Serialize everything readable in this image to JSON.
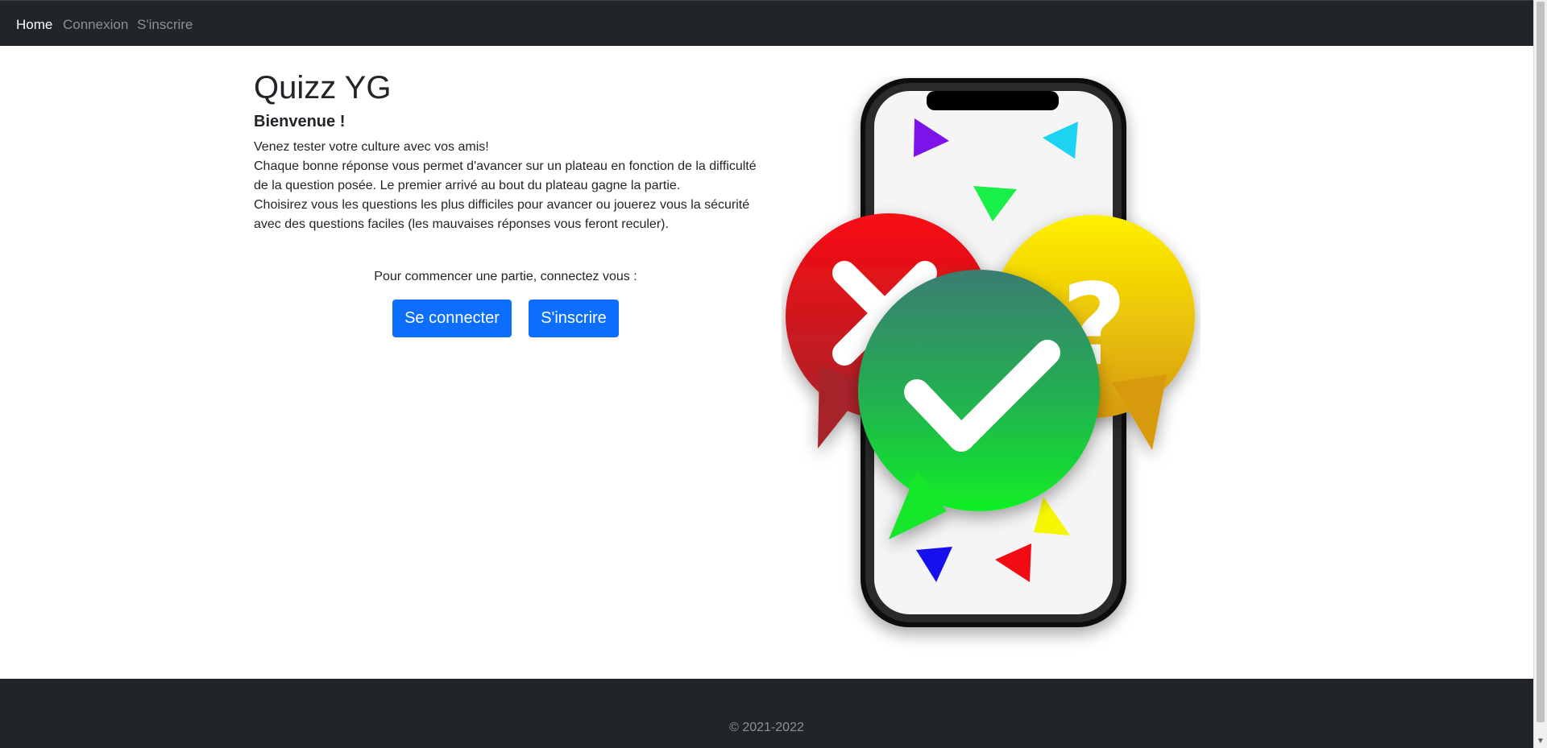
{
  "nav": {
    "home": "Home",
    "login": "Connexion",
    "signup": "S'inscrire"
  },
  "main": {
    "title": "Quizz YG",
    "subtitle": "Bienvenue !",
    "description": [
      "Venez tester votre culture avec vos amis!",
      "Chaque bonne réponse vous permet d'avancer sur un plateau en fonction de la difficulté de la question posée. Le premier arrivé au bout du plateau gagne la partie.",
      "Choisirez vous les questions les plus difficiles pour avancer ou jouerez vous la sécurité avec des questions faciles (les mauvaises réponses vous feront reculer)."
    ],
    "cta_text": "Pour commencer une partie, connectez vous :",
    "login_button": "Se connecter",
    "signup_button": "S'inscrire"
  },
  "illustration": {
    "icon": "quiz-phone-illustration",
    "bubble_wrong_color": "#e8121a",
    "bubble_question_color": "#f5d000",
    "bubble_correct_color": "#25b84b"
  },
  "footer": {
    "copyright": "© 2021-2022"
  },
  "colors": {
    "navbar": "#212529",
    "primary": "#0d6efd"
  }
}
